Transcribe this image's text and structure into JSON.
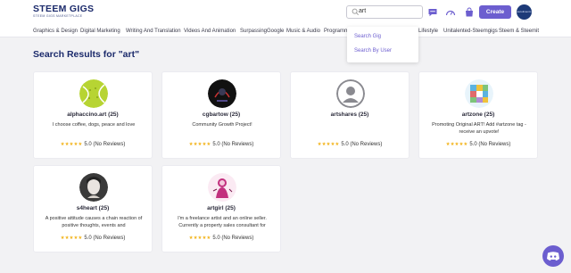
{
  "header": {
    "logo_text": "STEEM GIGS",
    "logo_tagline": "STEEM GIGS MARKETPLACE",
    "search_value": "art",
    "create_label": "Create",
    "avatar_text": "ascolimento"
  },
  "categories": [
    "Graphics & Design",
    "Digital Marketing",
    "Writing And Translation",
    "Videos And Animation",
    "SurpassingGoogle",
    "Music & Audio",
    "Programming",
    "Lifestyle",
    "Unitalented-Steemgigs",
    "Steem & Steemit"
  ],
  "search_dropdown": {
    "items": [
      "Search Gig",
      "Search By User"
    ]
  },
  "results": {
    "title": "Search Results for \"art\"",
    "cards": [
      {
        "name": "alphaccino.art (25)",
        "desc": "I choose coffee, dogs, peace and love",
        "rating": "5.0 (No Reviews)",
        "stars": 5,
        "avatar": "tennis-ball"
      },
      {
        "name": "cgbartow (25)",
        "desc": "Community Growth Project!",
        "rating": "5.0 (No Reviews)",
        "stars": 5,
        "avatar": "dark-art"
      },
      {
        "name": "artshares (25)",
        "desc": "",
        "rating": "5.0 (No Reviews)",
        "stars": 5,
        "avatar": "default-user"
      },
      {
        "name": "artzone (25)",
        "desc": "Promoting Original ART! Add #artzone tag - receive an upvote!",
        "rating": "5.0 (No Reviews)",
        "stars": 5,
        "avatar": "mosaic"
      },
      {
        "name": "s4heart (25)",
        "desc": "A positive attitude causes a chain reaction of positive thoughts, events and",
        "rating": "5.0 (No Reviews)",
        "stars": 5,
        "avatar": "portrait"
      },
      {
        "name": "artgirl (25)",
        "desc": "I'm a freelance artist and an online seller. Currently a property sales consultant for",
        "rating": "5.0 (No Reviews)",
        "stars": 5,
        "avatar": "pink-art"
      }
    ]
  },
  "colors": {
    "brand": "#1b2a6b",
    "accent": "#6c5ecf",
    "star": "#f3b51f",
    "background": "#f2f2f4"
  }
}
